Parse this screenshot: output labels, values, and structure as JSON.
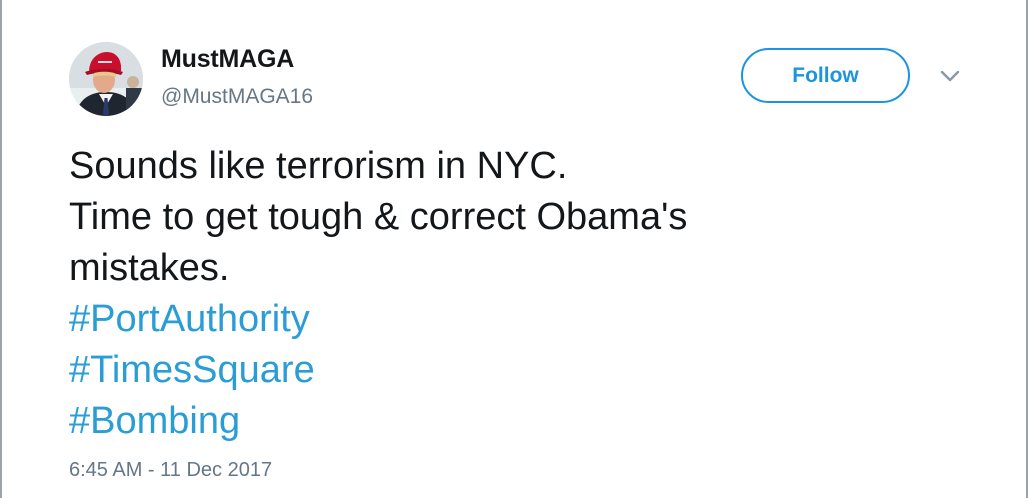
{
  "tweet": {
    "author": {
      "display_name": "MustMAGA",
      "handle": "@MustMAGA16",
      "avatar_icon": "profile-photo"
    },
    "follow_label": "Follow",
    "menu_icon": "chevron-down-icon",
    "text_lines": [
      "Sounds like terrorism in NYC.",
      "Time to get tough & correct Obama's",
      "mistakes."
    ],
    "hashtags": [
      "#PortAuthority",
      "#TimesSquare",
      "#Bombing"
    ],
    "timestamp": "6:45 AM - 11 Dec 2017"
  },
  "colors": {
    "accent": "#1b95e0",
    "hashtag": "#2b9dd6",
    "text": "#14171a",
    "muted": "#657786",
    "border": "#9aa3ab"
  }
}
